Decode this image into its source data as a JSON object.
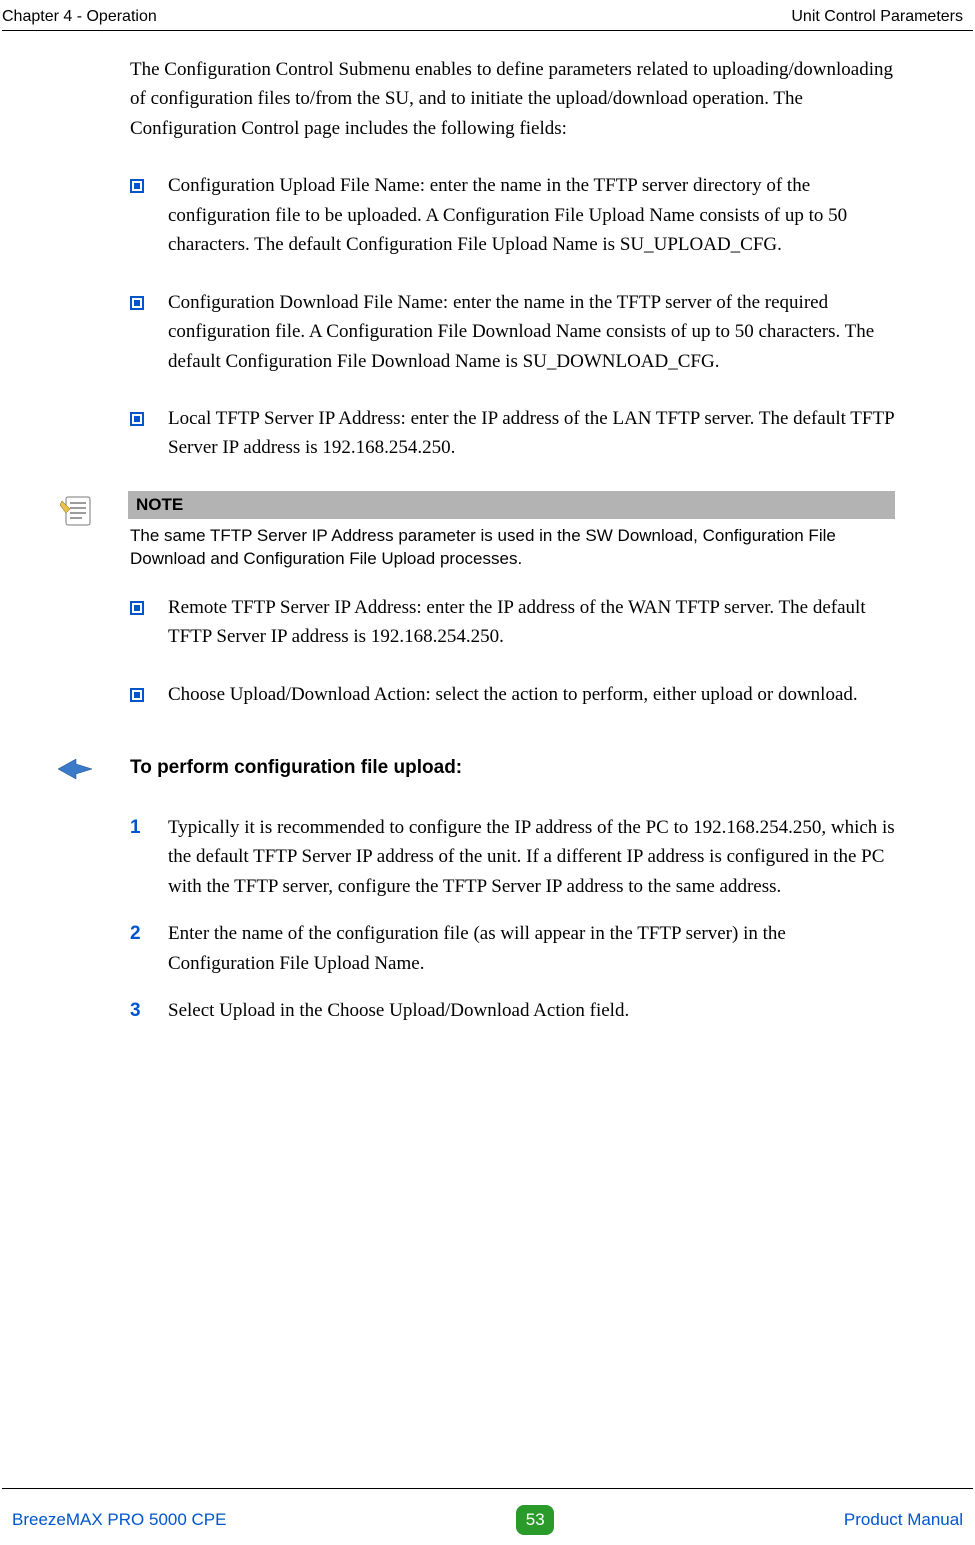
{
  "header": {
    "left": "Chapter 4 - Operation",
    "right": "Unit Control Parameters"
  },
  "intro": "The Configuration Control Submenu enables to define parameters related to uploading/downloading of configuration files to/from the SU, and to initiate the upload/download operation. The Configuration Control page includes the following fields:",
  "bullets": [
    "Configuration Upload File Name: enter the name in the TFTP server directory of the configuration file to be uploaded. A Configuration File Upload Name consists of up to 50 characters. The default Configuration File Upload Name is SU_UPLOAD_CFG.",
    "Configuration Download File Name: enter the name in the TFTP server of the required configuration file. A Configuration File Download Name consists of up to 50 characters. The default Configuration File Download Name is SU_DOWNLOAD_CFG.",
    "Local TFTP Server IP Address: enter the IP address of the LAN TFTP server. The default TFTP Server IP address is 192.168.254.250."
  ],
  "note": {
    "title": "NOTE",
    "text": "The same TFTP Server IP Address parameter is used in the SW Download, Configuration File Download and Configuration File Upload processes."
  },
  "bullets2": [
    "Remote TFTP Server IP Address: enter the IP address of the WAN TFTP server. The default TFTP Server IP address is 192.168.254.250.",
    "Choose Upload/Download Action: select the action to perform, either upload or download."
  ],
  "task_title": "To perform configuration file upload:",
  "steps": [
    {
      "num": "1",
      "text": "Typically it is recommended to configure the IP address of the PC to 192.168.254.250, which is the default TFTP Server IP address of the unit. If a different IP address is configured in the PC with the TFTP server, configure the TFTP Server IP address to the same address."
    },
    {
      "num": "2",
      "text": "Enter the name of the configuration file (as will appear in the TFTP server) in the Configuration File Upload Name."
    },
    {
      "num": "3",
      "text": "Select Upload in the Choose Upload/Download Action field."
    }
  ],
  "footer": {
    "left": "BreezeMAX PRO 5000 CPE",
    "page": "53",
    "right": "Product Manual"
  },
  "colors": {
    "accent_blue": "#0055cc",
    "badge_green": "#2a9b2a",
    "note_grey": "#b3b3b3"
  }
}
